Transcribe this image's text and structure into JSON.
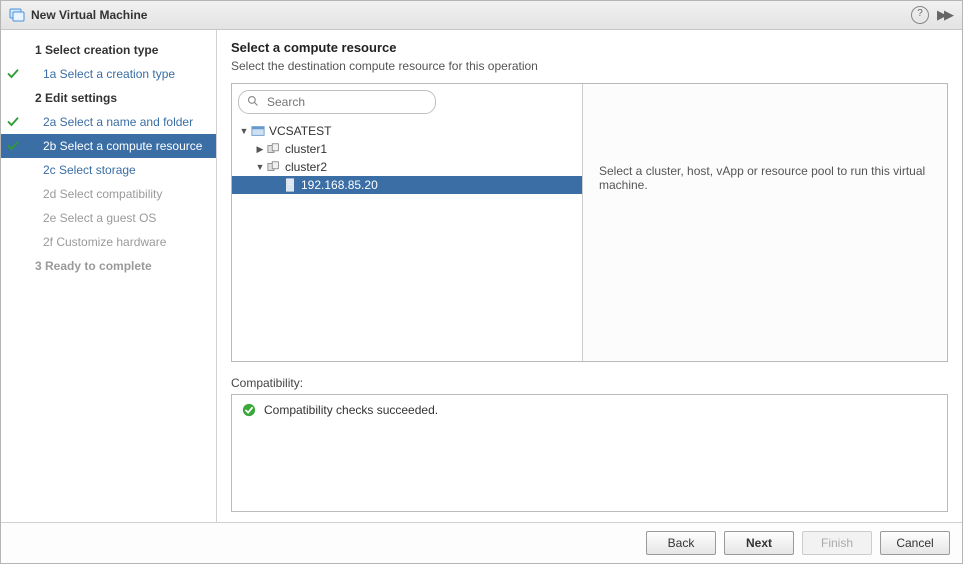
{
  "window": {
    "title": "New Virtual Machine"
  },
  "steps": {
    "s1": {
      "label": "1  Select creation type"
    },
    "s1a": {
      "label": "1a  Select a creation type"
    },
    "s2": {
      "label": "2  Edit settings"
    },
    "s2a": {
      "label": "2a  Select a name and folder"
    },
    "s2b": {
      "label": "2b  Select a compute resource"
    },
    "s2c": {
      "label": "2c  Select storage"
    },
    "s2d": {
      "label": "2d  Select compatibility"
    },
    "s2e": {
      "label": "2e  Select a guest OS"
    },
    "s2f": {
      "label": "2f  Customize hardware"
    },
    "s3": {
      "label": "3  Ready to complete"
    }
  },
  "header": {
    "title": "Select a compute resource",
    "subtitle": "Select the destination compute resource for this operation"
  },
  "search": {
    "placeholder": "Search"
  },
  "tree": {
    "root": {
      "label": "VCSATEST"
    },
    "c1": {
      "label": "cluster1"
    },
    "c2": {
      "label": "cluster2"
    },
    "host1": {
      "label": "192.168.85.20"
    }
  },
  "hint": {
    "text": "Select a cluster, host, vApp or resource pool to run this virtual machine."
  },
  "compat": {
    "label": "Compatibility:",
    "message": "Compatibility checks succeeded."
  },
  "buttons": {
    "back": "Back",
    "next": "Next",
    "finish": "Finish",
    "cancel": "Cancel"
  }
}
